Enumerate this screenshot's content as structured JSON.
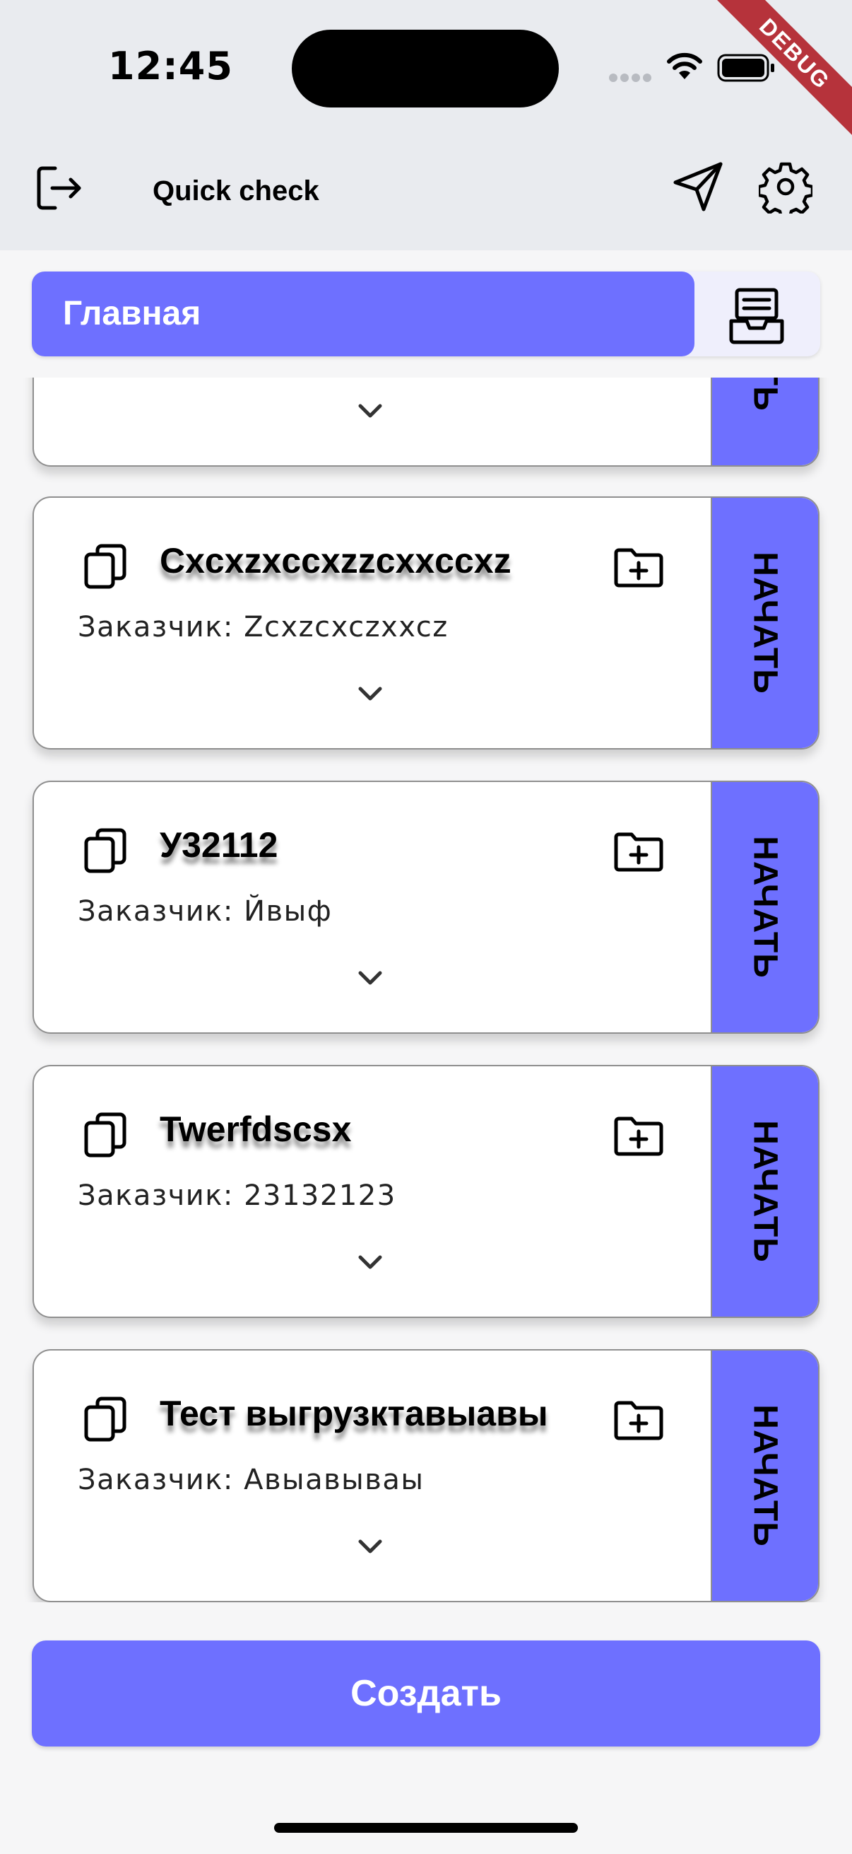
{
  "status_bar": {
    "time": "12:45",
    "debug_label": "DEBUG"
  },
  "header": {
    "title": "Quick check"
  },
  "tabs": {
    "main_label": "Главная"
  },
  "colors": {
    "accent": "#6e70ff",
    "header_bg": "#e9ebef",
    "debug": "#b6333b"
  },
  "icons": {
    "logout": "logout-icon",
    "send": "send-icon",
    "settings": "gear-icon",
    "inbox": "inbox-icon",
    "copy": "copy-icon",
    "folder_add": "folder-add-icon",
    "expand": "chevron-down-icon"
  },
  "cards": [
    {
      "title": "",
      "customer": "",
      "start_label": "НАЧАТЬ"
    },
    {
      "title": "Cxcxzxccxzzcxxccxz",
      "customer": "Заказчик: Zcxzcxczxxcz",
      "start_label": "НАЧАТЬ"
    },
    {
      "title": "У32112",
      "customer": "Заказчик: Йвыф",
      "start_label": "НАЧАТЬ"
    },
    {
      "title": "Twerfdscsx",
      "customer": "Заказчик: 23132123",
      "start_label": "НАЧАТЬ"
    },
    {
      "title": "Тест выгрузктавыавы",
      "customer": "Заказчик: Авыавываы",
      "start_label": "НАЧАТЬ"
    }
  ],
  "footer": {
    "create_label": "Создать"
  }
}
